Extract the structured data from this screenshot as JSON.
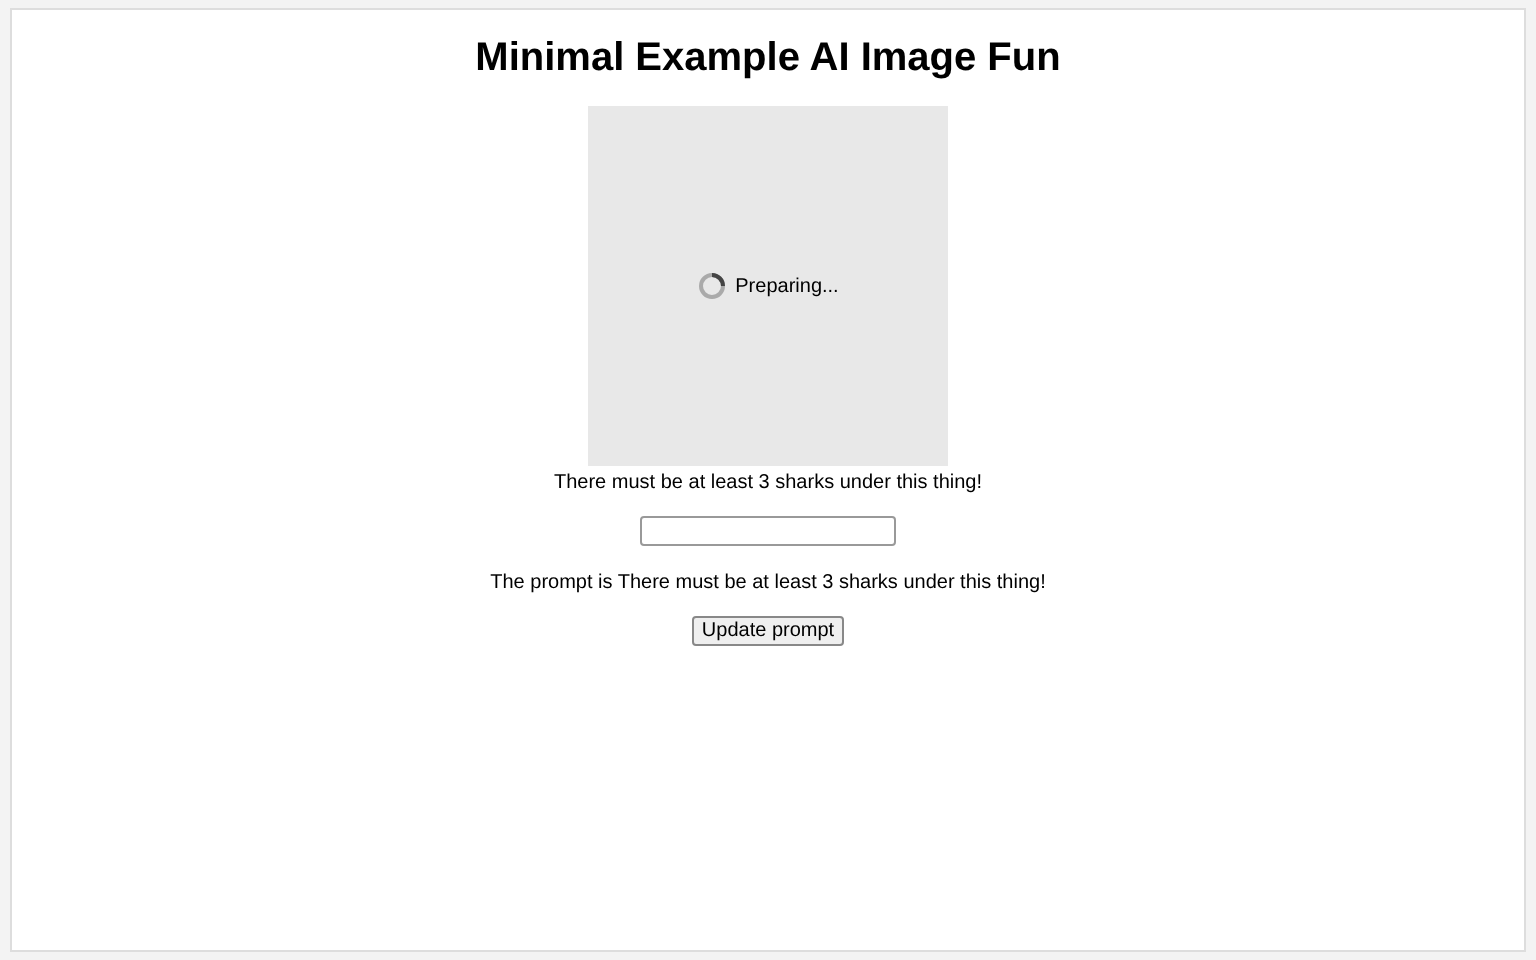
{
  "title": "Minimal Example AI Image Fun",
  "image_area": {
    "status": "Preparing..."
  },
  "caption": "There must be at least 3 sharks under this thing!",
  "prompt_text": "The prompt is There must be at least 3 sharks under this thing!",
  "button": "Update prompt"
}
